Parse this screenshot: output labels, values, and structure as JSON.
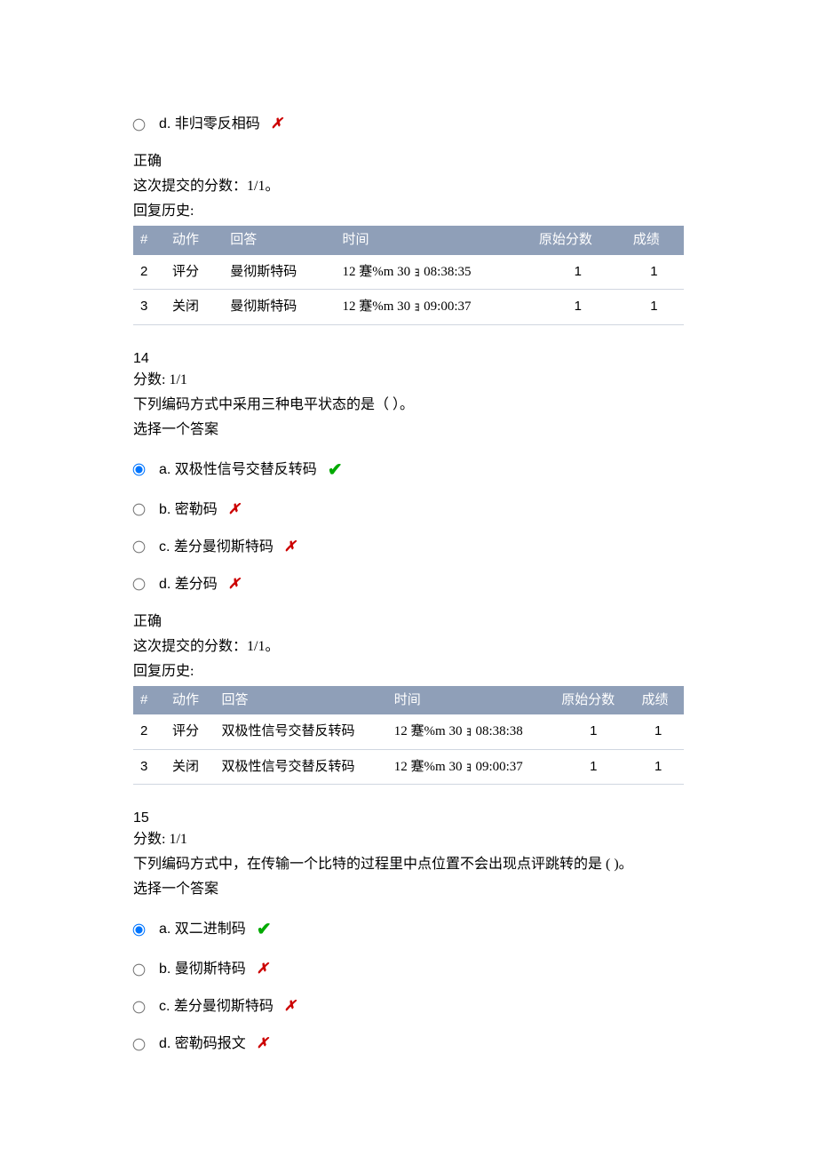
{
  "q_prev": {
    "option_d_prefix": "d. ",
    "option_d_text": "非归零反相码",
    "correct": "正确",
    "score_line": "这次提交的分数：1/1。",
    "history_label": "回复历史:",
    "headers": {
      "num": "#",
      "action": "动作",
      "answer": "回答",
      "time": "时间",
      "raw": "原始分数",
      "grade": "成绩"
    },
    "rows": [
      {
        "num": "2",
        "action": "评分",
        "answer": "曼彻斯特码",
        "time": "12 蹇%m 30 ｮ 08:38:35",
        "raw": "1",
        "grade": "1"
      },
      {
        "num": "3",
        "action": "关闭",
        "answer": "曼彻斯特码",
        "time": "12 蹇%m 30 ｮ 09:00:37",
        "raw": "1",
        "grade": "1"
      }
    ]
  },
  "q14": {
    "number": "14",
    "score": "分数: 1/1",
    "prompt": "下列编码方式中采用三种电平状态的是（ ）。",
    "choose": "选择一个答案",
    "options": {
      "a": {
        "prefix": "a. ",
        "text": "双极性信号交替反转码",
        "selected": true,
        "correct": true
      },
      "b": {
        "prefix": "b. ",
        "text": "密勒码",
        "selected": false,
        "correct": false
      },
      "c": {
        "prefix": "c. ",
        "text": "差分曼彻斯特码",
        "selected": false,
        "correct": false
      },
      "d": {
        "prefix": "d. ",
        "text": "差分码",
        "selected": false,
        "correct": false
      }
    },
    "correct": "正确",
    "score_line": "这次提交的分数：1/1。",
    "history_label": "回复历史:",
    "headers": {
      "num": "#",
      "action": "动作",
      "answer": "回答",
      "time": "时间",
      "raw": "原始分数",
      "grade": "成绩"
    },
    "rows": [
      {
        "num": "2",
        "action": "评分",
        "answer": "双极性信号交替反转码",
        "time": "12 蹇%m 30 ｮ 08:38:38",
        "raw": "1",
        "grade": "1"
      },
      {
        "num": "3",
        "action": "关闭",
        "answer": "双极性信号交替反转码",
        "time": "12 蹇%m 30 ｮ 09:00:37",
        "raw": "1",
        "grade": "1"
      }
    ]
  },
  "q15": {
    "number": "15",
    "score": "分数: 1/1",
    "prompt": "下列编码方式中，在传输一个比特的过程里中点位置不会出现点评跳转的是 ( )。",
    "choose": "选择一个答案",
    "options": {
      "a": {
        "prefix": "a. ",
        "text": "双二进制码",
        "selected": true,
        "correct": true
      },
      "b": {
        "prefix": "b. ",
        "text": "曼彻斯特码",
        "selected": false,
        "correct": false
      },
      "c": {
        "prefix": "c. ",
        "text": "差分曼彻斯特码",
        "selected": false,
        "correct": false
      },
      "d": {
        "prefix": "d. ",
        "text": "密勒码报文",
        "selected": false,
        "correct": false
      }
    }
  }
}
